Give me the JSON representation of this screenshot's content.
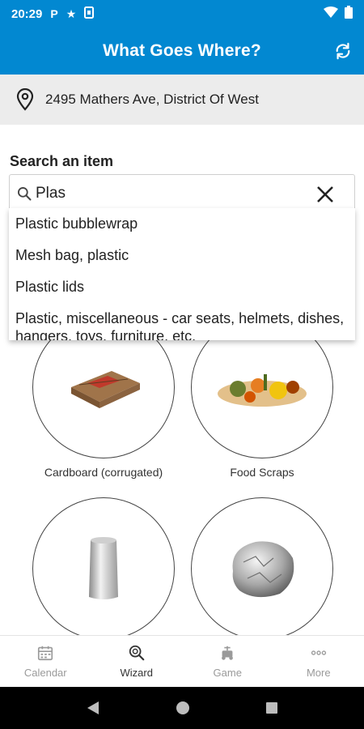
{
  "status_bar": {
    "time": "20:29",
    "icons_left": [
      "parking-icon",
      "star-icon",
      "sim-icon"
    ],
    "icons_right": [
      "wifi-icon",
      "battery-icon"
    ]
  },
  "app_bar": {
    "title": "What Goes Where?",
    "action_icon": "refresh-icon"
  },
  "address": {
    "text": "2495 Mathers Ave, District Of West",
    "icon": "location-pin-icon"
  },
  "search": {
    "label": "Search an item",
    "value": "Plas",
    "placeholder": ""
  },
  "suggestions": [
    "Plastic bubblewrap",
    "Mesh bag, plastic",
    "Plastic lids",
    "Plastic, miscellaneous - car seats, helmets, dishes, hangers, toys, furniture, etc."
  ],
  "categories": [
    {
      "label": "Cardboard (corrugated)",
      "icon": "cardboard-image"
    },
    {
      "label": "Food Scraps",
      "icon": "food-scraps-image"
    },
    {
      "label": "",
      "icon": "aluminum-can-image"
    },
    {
      "label": "",
      "icon": "aluminum-foil-ball-image"
    }
  ],
  "bottom_nav": [
    {
      "label": "Calendar",
      "icon": "calendar-icon",
      "active": false
    },
    {
      "label": "Wizard",
      "icon": "wizard-search-icon",
      "active": true
    },
    {
      "label": "Game",
      "icon": "game-icon",
      "active": false
    },
    {
      "label": "More",
      "icon": "more-icon",
      "active": false
    }
  ],
  "colors": {
    "primary": "#0288d1",
    "address_bg": "#ececec",
    "nav_active": "#333333",
    "nav_inactive": "#9a9a9a"
  }
}
